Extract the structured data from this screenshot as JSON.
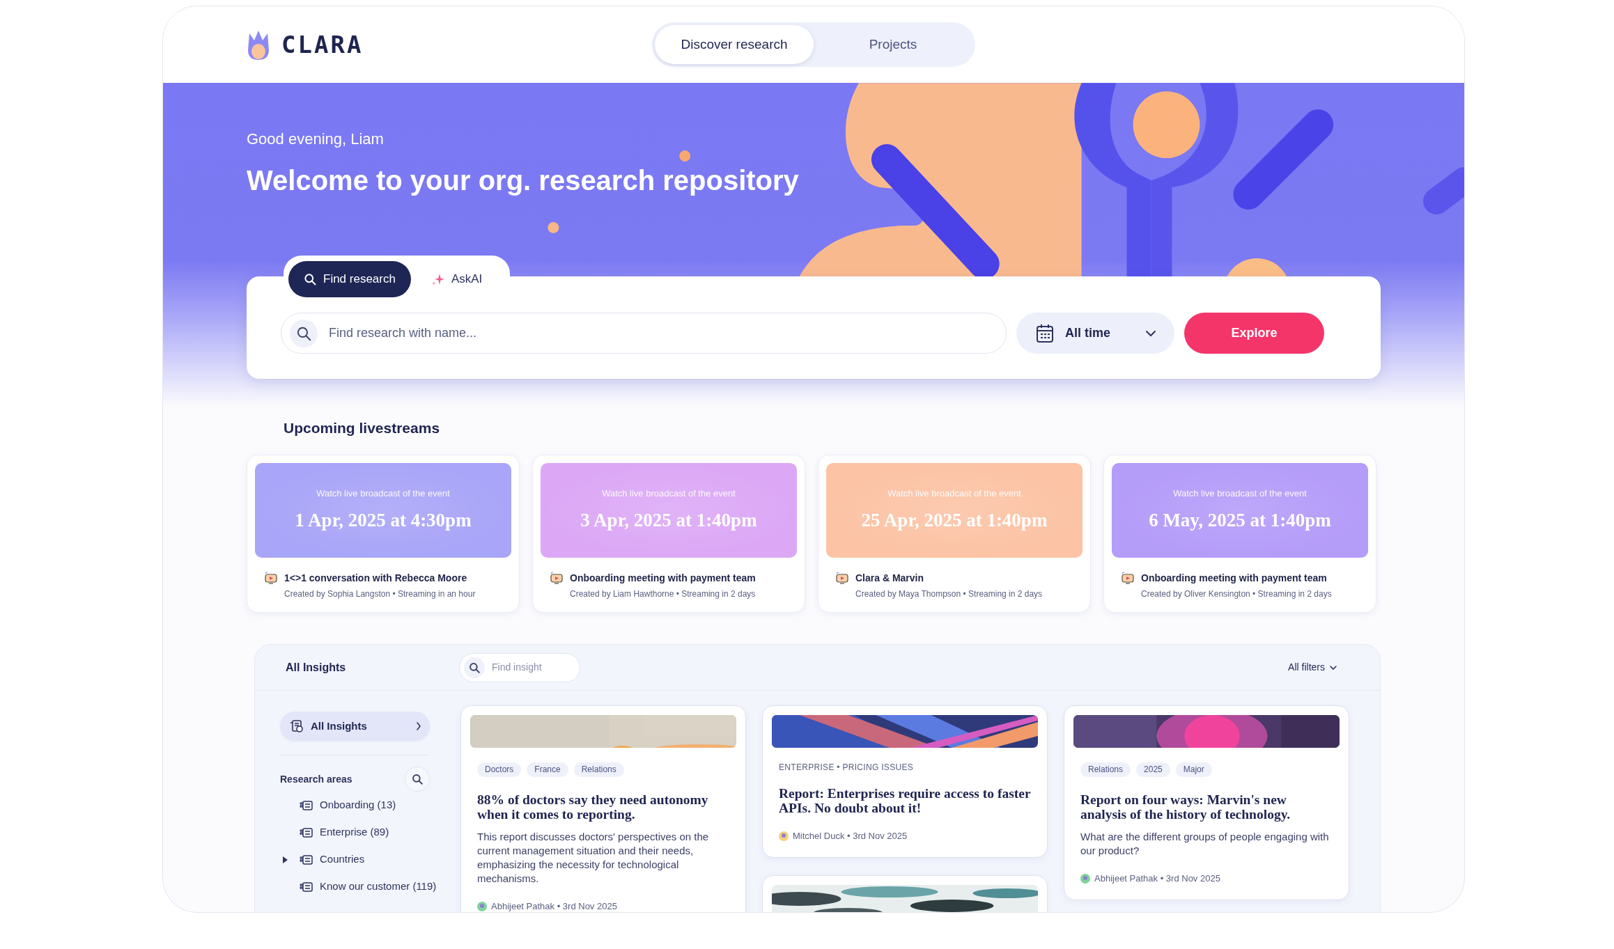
{
  "header": {
    "logo": "CLARA",
    "nav": [
      {
        "label": "Discover research",
        "selected": true
      },
      {
        "label": "Projects",
        "selected": false
      }
    ]
  },
  "hero": {
    "greeting": "Good evening, Liam",
    "title": "Welcome to your org. research repository"
  },
  "search": {
    "tabs": [
      {
        "label": "Find research",
        "kind": "search",
        "selected": true
      },
      {
        "label": "AskAI",
        "kind": "ai",
        "selected": false
      }
    ],
    "placeholder": "Find research with name...",
    "date_filter": "All time",
    "button": "Explore"
  },
  "livestreams": {
    "title": "Upcoming livestreams",
    "items": [
      {
        "caption": "Watch live broadcast of the event",
        "date": "1 Apr, 2025 at 4:30pm",
        "color": "#a9a5f8",
        "title": "1<>1 conversation with Rebecca Moore",
        "meta": "Created by Sophia Langston • Streaming in an hour"
      },
      {
        "caption": "Watch live broadcast of the event",
        "date": "3 Apr, 2025 at 1:40pm",
        "color": "#dca8f6",
        "title": "Onboarding meeting with payment team",
        "meta": "Created by Liam Hawthorne • Streaming in 2 days"
      },
      {
        "caption": "Watch live broadcast of the event",
        "date": "25 Apr, 2025 at 1:40pm",
        "color": "#fcc3a5",
        "title": "Clara & Marvin",
        "meta": "Created by Maya Thompson • Streaming in 2 days"
      },
      {
        "caption": "Watch live broadcast of the event",
        "date": "6 May, 2025 at 1:40pm",
        "color": "#b49cf9",
        "title": "Onboarding meeting with payment team",
        "meta": "Created by Oliver Kensington • Streaming in 2 days"
      }
    ]
  },
  "insights": {
    "title": "All Insights",
    "search_placeholder": "Find insight",
    "filters": "All filters",
    "sidebar": {
      "all_item": {
        "label": "All Insights",
        "selected": true
      },
      "section_title": "Research areas",
      "areas": [
        {
          "label": "Onboarding (13)",
          "kind": "area"
        },
        {
          "label": "Enterprise (89)",
          "kind": "area"
        },
        {
          "label": "Countries",
          "kind": "group"
        },
        {
          "label": "Know our customer (119)",
          "kind": "area"
        }
      ]
    },
    "columns": [
      [
        {
          "kind": "tagged",
          "tags": [
            "Doctors",
            "France",
            "Relations"
          ],
          "title": "88% of doctors say they need autonomy when it comes to reporting.",
          "body": "This report discusses doctors' perspectives on the current management situation and their needs, emphasizing the necessity for technological mechanisms.",
          "byline": "Abhijeet Pathak • 3rd Nov 2025"
        }
      ],
      [
        {
          "kind": "category",
          "category": "ENTERPRISE • PRICING ISSUES",
          "title": "Report: Enterprises require access to faster APIs. No doubt about it!",
          "byline": "Mitchel Duck • 3rd Nov 2025"
        },
        {
          "kind": "picture"
        }
      ],
      [
        {
          "kind": "tagged",
          "tags": [
            "Relations",
            "2025",
            "Major"
          ],
          "title": "Report on four ways: Marvin's new analysis of the history of technology.",
          "body": "What are the different groups of people engaging with our product?",
          "byline": "Abhijeet Pathak • 3rd Nov 2025"
        }
      ]
    ]
  }
}
